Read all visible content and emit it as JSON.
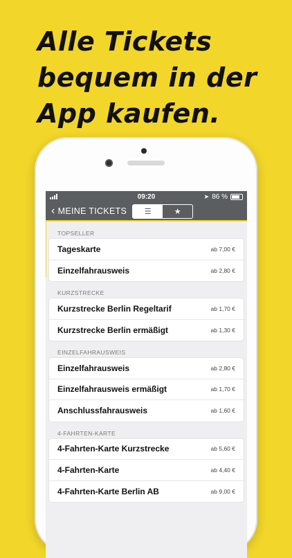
{
  "headline": [
    "Alle Tickets",
    "bequem in der",
    "App kaufen."
  ],
  "status_bar": {
    "time": "09:20",
    "battery": "86 %"
  },
  "nav": {
    "back_label": "MEINE TICKETS"
  },
  "sections": [
    {
      "title": "TOPSELLER",
      "items": [
        {
          "name": "Tageskarte",
          "price": "ab 7,00 €"
        },
        {
          "name": "Einzelfahrausweis",
          "price": "ab 2,80 €"
        }
      ]
    },
    {
      "title": "KURZSTRECKE",
      "items": [
        {
          "name": "Kurzstrecke Berlin Regeltarif",
          "price": "ab 1,70 €"
        },
        {
          "name": "Kurzstrecke Berlin ermäßigt",
          "price": "ab 1,30 €"
        }
      ]
    },
    {
      "title": "EINZELFAHRAUSWEIS",
      "items": [
        {
          "name": "Einzelfahrausweis",
          "price": "ab 2,80 €"
        },
        {
          "name": "Einzelfahrausweis ermäßigt",
          "price": "ab 1,70 €"
        },
        {
          "name": "Anschlussfahrausweis",
          "price": "ab 1,60 €"
        }
      ]
    },
    {
      "title": "4-FAHRTEN-KARTE",
      "items": [
        {
          "name": "4-Fahrten-Karte Kurzstrecke",
          "price": "ab 5,60 €"
        },
        {
          "name": "4-Fahrten-Karte",
          "price": "ab 4,40 €"
        },
        {
          "name": "4-Fahrten-Karte Berlin AB",
          "price": "ab 9,00 €"
        }
      ]
    }
  ],
  "colors": {
    "brand_yellow": "#f2d62a",
    "navbar": "#5a5e60"
  },
  "icons": {
    "back": "chevron-left-icon",
    "list": "list-icon",
    "favorites": "star-icon"
  }
}
